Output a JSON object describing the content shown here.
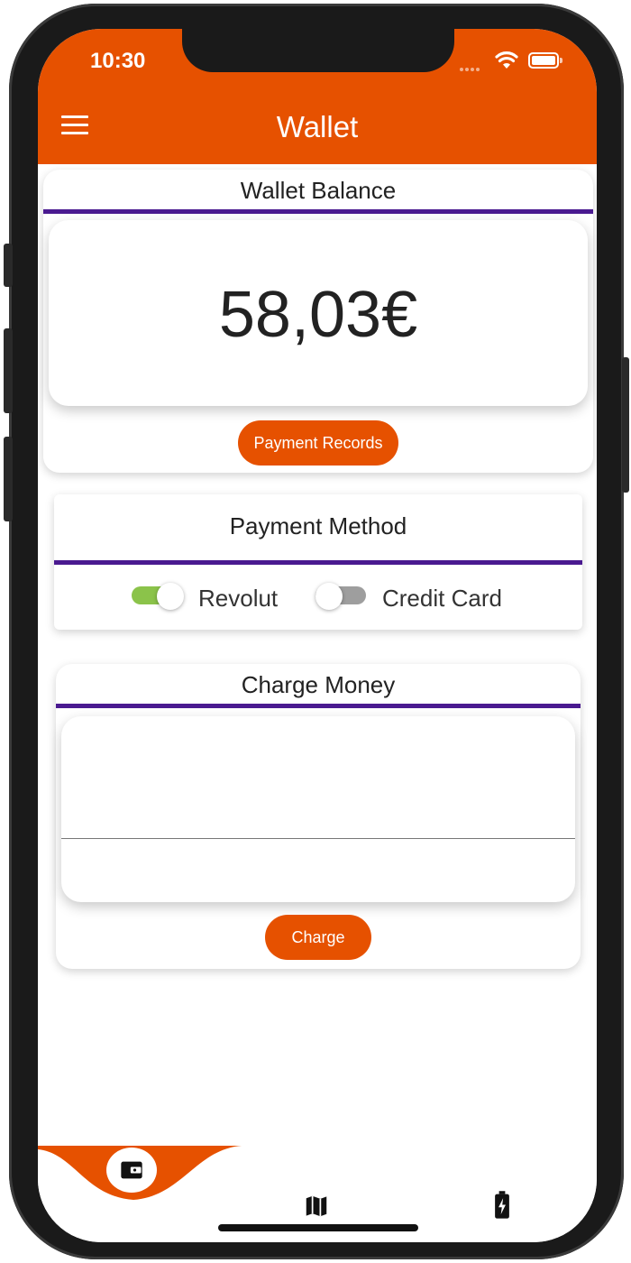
{
  "status_bar": {
    "time": "10:30"
  },
  "app_bar": {
    "title": "Wallet",
    "menu_icon": "hamburger-menu-icon"
  },
  "wallet_balance": {
    "header": "Wallet Balance",
    "amount": "58,03€",
    "records_button": "Payment Records"
  },
  "payment_method": {
    "header": "Payment Method",
    "options": [
      {
        "label": "Revolut",
        "enabled": true
      },
      {
        "label": "Credit Card",
        "enabled": false
      }
    ]
  },
  "charge_money": {
    "header": "Charge Money",
    "input_value": "",
    "charge_button": "Charge"
  },
  "bottom_nav": {
    "items": [
      {
        "icon": "wallet-icon",
        "active": true
      },
      {
        "icon": "map-icon",
        "active": false
      },
      {
        "icon": "battery-charging-icon",
        "active": false
      }
    ]
  },
  "colors": {
    "primary": "#e65100",
    "divider": "#4a1a90",
    "toggle_on": "#8bc34a",
    "toggle_off": "#9e9e9e"
  }
}
